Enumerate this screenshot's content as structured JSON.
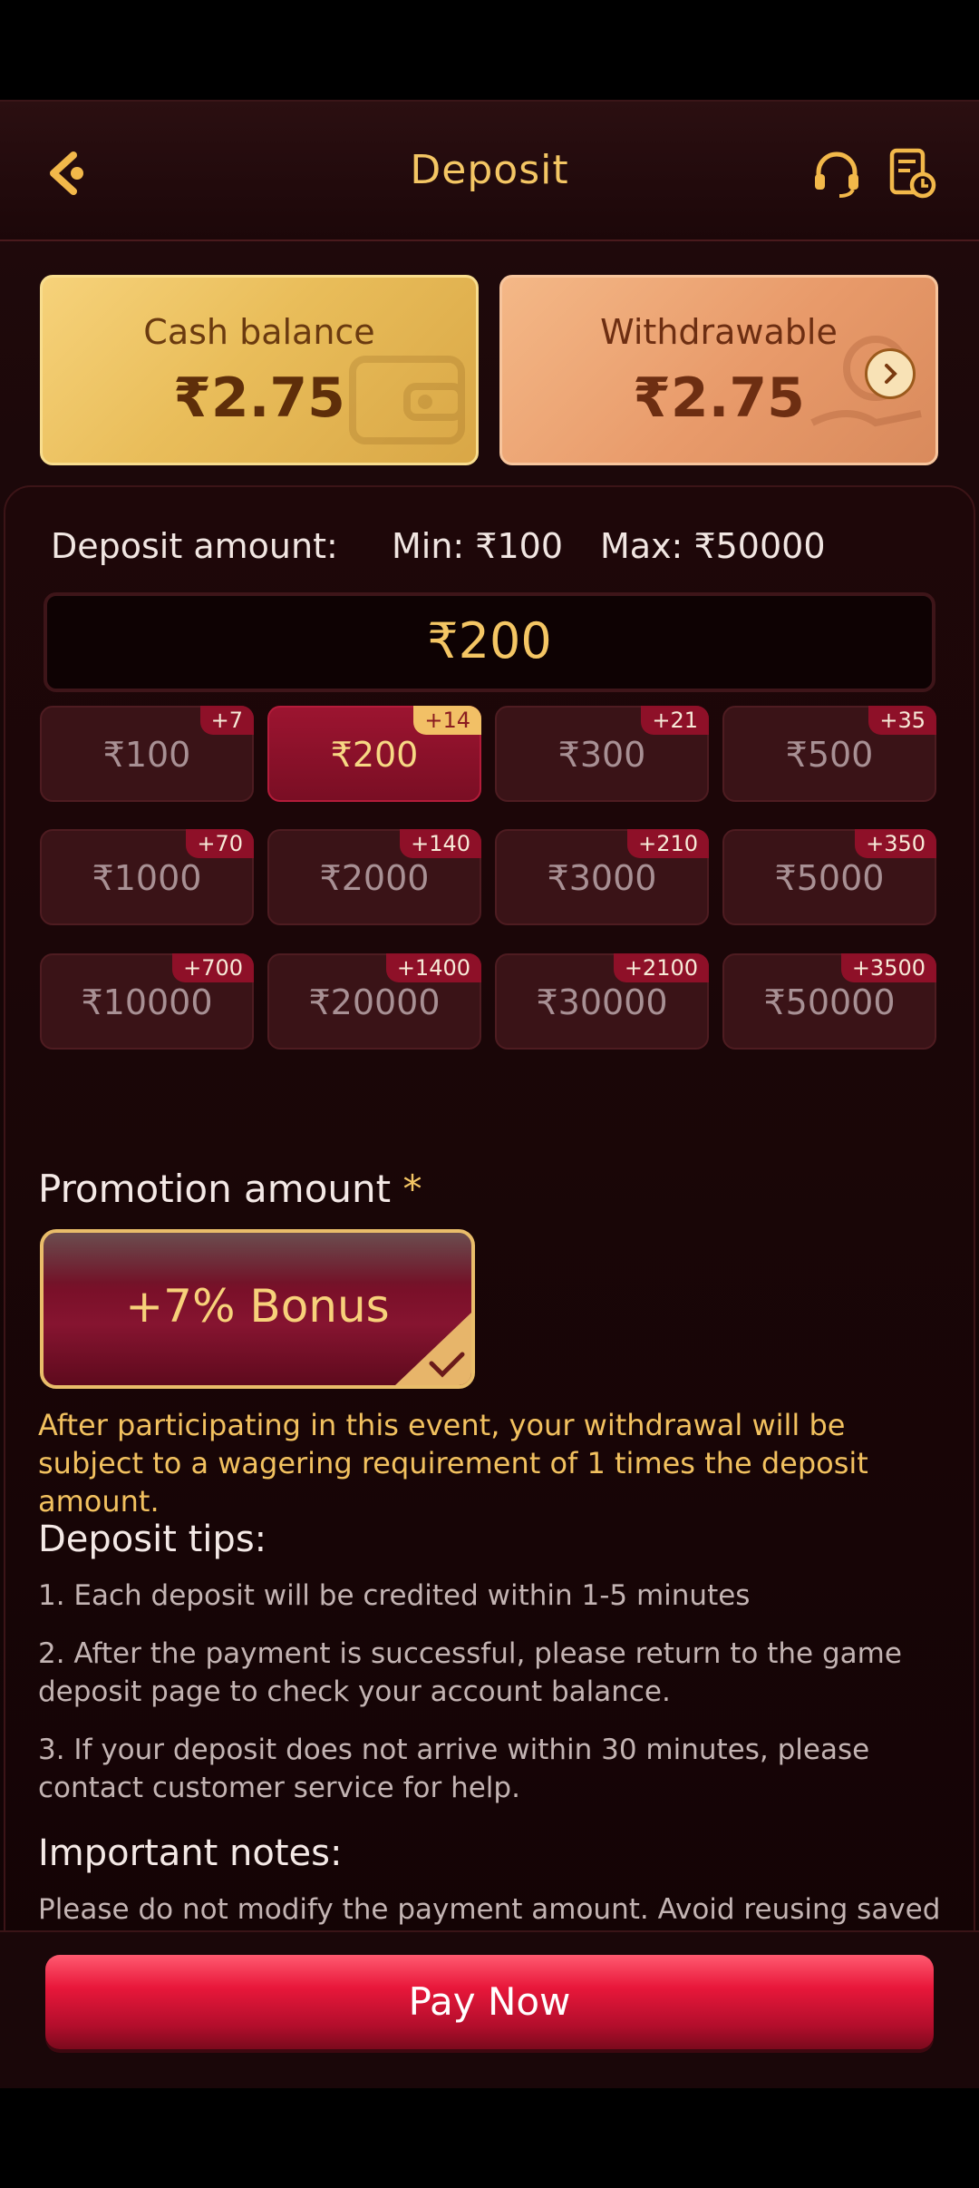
{
  "header": {
    "title": "Deposit"
  },
  "balances": {
    "cash_label": "Cash balance",
    "cash_amount": "₹2.75",
    "withdrawable_label": "Withdrawable",
    "withdrawable_amount": "₹2.75"
  },
  "deposit": {
    "label": "Deposit amount:",
    "min": "Min: ₹100",
    "max": "Max: ₹50000",
    "input_value": "₹200",
    "options": [
      {
        "amount": "₹100",
        "bonus": "+7"
      },
      {
        "amount": "₹200",
        "bonus": "+14",
        "selected": true
      },
      {
        "amount": "₹300",
        "bonus": "+21"
      },
      {
        "amount": "₹500",
        "bonus": "+35"
      },
      {
        "amount": "₹1000",
        "bonus": "+70"
      },
      {
        "amount": "₹2000",
        "bonus": "+140"
      },
      {
        "amount": "₹3000",
        "bonus": "+210"
      },
      {
        "amount": "₹5000",
        "bonus": "+350"
      },
      {
        "amount": "₹10000",
        "bonus": "+700"
      },
      {
        "amount": "₹20000",
        "bonus": "+1400"
      },
      {
        "amount": "₹30000",
        "bonus": "+2100"
      },
      {
        "amount": "₹50000",
        "bonus": "+3500"
      }
    ]
  },
  "promotion": {
    "title": "Promotion amount",
    "required_mark": "*",
    "option_label": "+7% Bonus",
    "note": "After participating in this event, your withdrawal will be subject to a wagering requirement of 1 times the deposit amount."
  },
  "tips": {
    "title": "Deposit tips:",
    "items": [
      "1. Each deposit will be credited within 1-5 minutes",
      "2. After the payment is successful, please return to the game deposit page to check your account balance.",
      "3. If your deposit does not arrive within 30 minutes, please contact customer service for help."
    ]
  },
  "notes": {
    "title": "Important notes:",
    "text": "Please do not modify the payment amount. Avoid reusing saved QR codes or UPI accounts for multiple payments."
  },
  "footer": {
    "pay_label": "Pay Now"
  },
  "colors": {
    "accent_gold": "#f4c664",
    "primary_red": "#e01a3c",
    "background": "#160607"
  },
  "icons": [
    "back-icon",
    "headset-icon",
    "history-icon",
    "chevron-right-icon",
    "check-icon"
  ]
}
